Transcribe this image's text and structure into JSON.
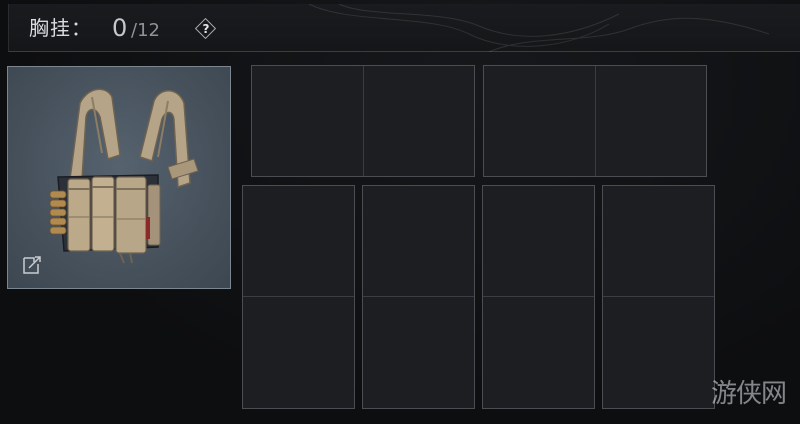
{
  "header": {
    "title": "胸挂：",
    "current_count": "0",
    "max_count": "/12",
    "help_label": "?"
  },
  "equipped_item": {
    "icon": "chest-rig",
    "swap_icon": "swap-icon"
  },
  "slot_grid": {
    "top_row": [
      {
        "name": "slot-top-1",
        "cells": 2,
        "orientation": "horizontal"
      },
      {
        "name": "slot-top-2",
        "cells": 2,
        "orientation": "horizontal"
      }
    ],
    "bottom_row": [
      {
        "name": "slot-bottom-1",
        "cells": 2,
        "orientation": "vertical"
      },
      {
        "name": "slot-bottom-2",
        "cells": 2,
        "orientation": "vertical"
      },
      {
        "name": "slot-bottom-3",
        "cells": 2,
        "orientation": "vertical"
      },
      {
        "name": "slot-bottom-4",
        "cells": 2,
        "orientation": "vertical"
      }
    ]
  },
  "watermark": "游侠网",
  "colors": {
    "background": "#0e0f11",
    "slot_fill": "#1c1e21",
    "slot_border": "#4a4e53",
    "item_bg": "#4b5661",
    "text": "#d9dbde"
  }
}
